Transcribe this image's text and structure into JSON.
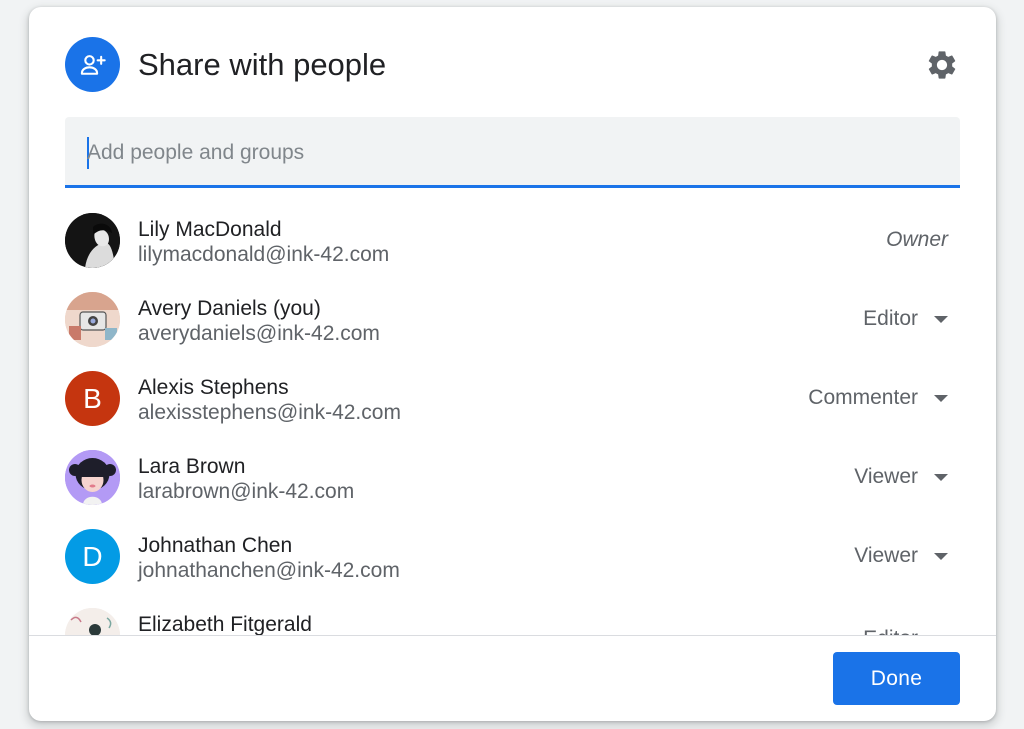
{
  "dialog": {
    "title": "Share with people",
    "header_icon": "person-add-icon",
    "settings_icon": "gear-icon"
  },
  "search": {
    "placeholder": "Add people and groups",
    "value": ""
  },
  "people": [
    {
      "name": "Lily MacDonald",
      "email": "lilymacdonald@ink-42.com",
      "role": "Owner",
      "avatar": "photo"
    },
    {
      "name": "Avery Daniels (you)",
      "email": "averydaniels@ink-42.com",
      "role": "Editor",
      "avatar": "photo"
    },
    {
      "name": "Alexis Stephens",
      "email": "alexisstephens@ink-42.com",
      "role": "Commenter",
      "avatar": "B",
      "avatar_color": "#c5350f"
    },
    {
      "name": "Lara Brown",
      "email": "larabrown@ink-42.com",
      "role": "Viewer",
      "avatar": "illustration"
    },
    {
      "name": "Johnathan Chen",
      "email": "johnathanchen@ink-42.com",
      "role": "Viewer",
      "avatar": "D",
      "avatar_color": "#039be5"
    },
    {
      "name": "Elizabeth Fitgerald",
      "email": "",
      "role": "Editor",
      "avatar": "photo"
    }
  ],
  "footer": {
    "done_label": "Done"
  },
  "colors": {
    "accent": "#1a73e8",
    "text_primary": "#202124",
    "text_secondary": "#5f6368"
  }
}
